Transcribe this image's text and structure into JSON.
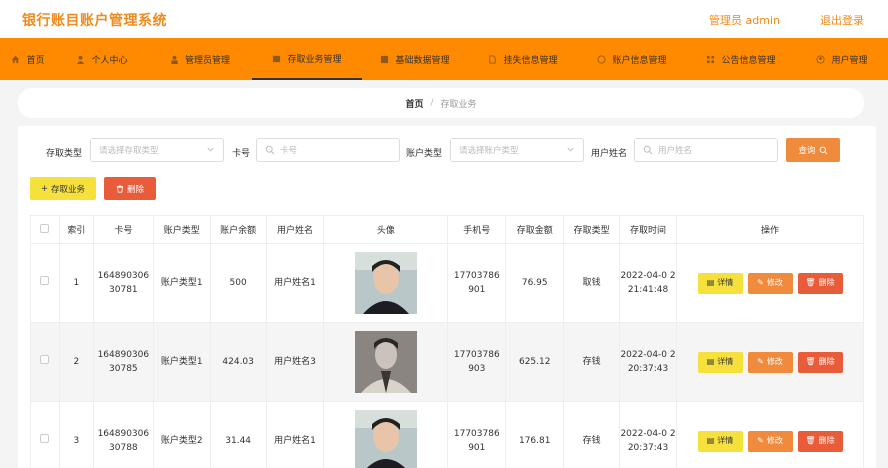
{
  "header": {
    "title": "银行账目账户管理系统",
    "admin_label": "管理员 admin",
    "logout_label": "退出登录"
  },
  "nav": [
    {
      "label": "首页",
      "icon": "home-icon"
    },
    {
      "label": "个人中心",
      "icon": "user-icon"
    },
    {
      "label": "管理员管理",
      "icon": "admin-icon"
    },
    {
      "label": "存取业务管理",
      "icon": "wallet-icon",
      "active": true
    },
    {
      "label": "基础数据管理",
      "icon": "grid-icon"
    },
    {
      "label": "挂失信息管理",
      "icon": "file-icon"
    },
    {
      "label": "账户信息管理",
      "icon": "circle-icon"
    },
    {
      "label": "公告信息管理",
      "icon": "apps-icon"
    },
    {
      "label": "用户管理",
      "icon": "circle-user-icon"
    }
  ],
  "breadcrumb": {
    "home": "首页",
    "separator": "/",
    "current": "存取业务"
  },
  "filters": {
    "type_label": "存取类型",
    "type_placeholder": "请选择存取类型",
    "card_label": "卡号",
    "card_placeholder": "卡号",
    "acct_type_label": "账户类型",
    "acct_type_placeholder": "请选择账户类型",
    "name_label": "用户姓名",
    "name_placeholder": "用户姓名",
    "query_label": "查询"
  },
  "actions": {
    "add_label": "存取业务",
    "delete_label": "删除"
  },
  "table": {
    "headers": [
      "索引",
      "卡号",
      "账户类型",
      "账户余额",
      "用户姓名",
      "头像",
      "手机号",
      "存取金额",
      "存取类型",
      "存取时间",
      "操作"
    ],
    "rows": [
      {
        "index": "1",
        "card": "164890306 30781",
        "acct_type": "账户类型1",
        "balance": "500",
        "name": "用户姓名1",
        "phone": "17703786 901",
        "amount": "76.95",
        "type": "取钱",
        "time": "2022-04-0 2 21:41:48"
      },
      {
        "index": "2",
        "card": "164890306 30785",
        "acct_type": "账户类型1",
        "balance": "424.03",
        "name": "用户姓名3",
        "phone": "17703786 903",
        "amount": "625.12",
        "type": "存钱",
        "time": "2022-04-0 2 20:37:43"
      },
      {
        "index": "3",
        "card": "164890306 30788",
        "acct_type": "账户类型2",
        "balance": "31.44",
        "name": "用户姓名1",
        "phone": "17703786 901",
        "amount": "176.81",
        "type": "存钱",
        "time": "2022-04-0 2 20:37:43"
      }
    ],
    "ops": {
      "detail": "详情",
      "edit": "修改",
      "delete": "删除"
    }
  }
}
